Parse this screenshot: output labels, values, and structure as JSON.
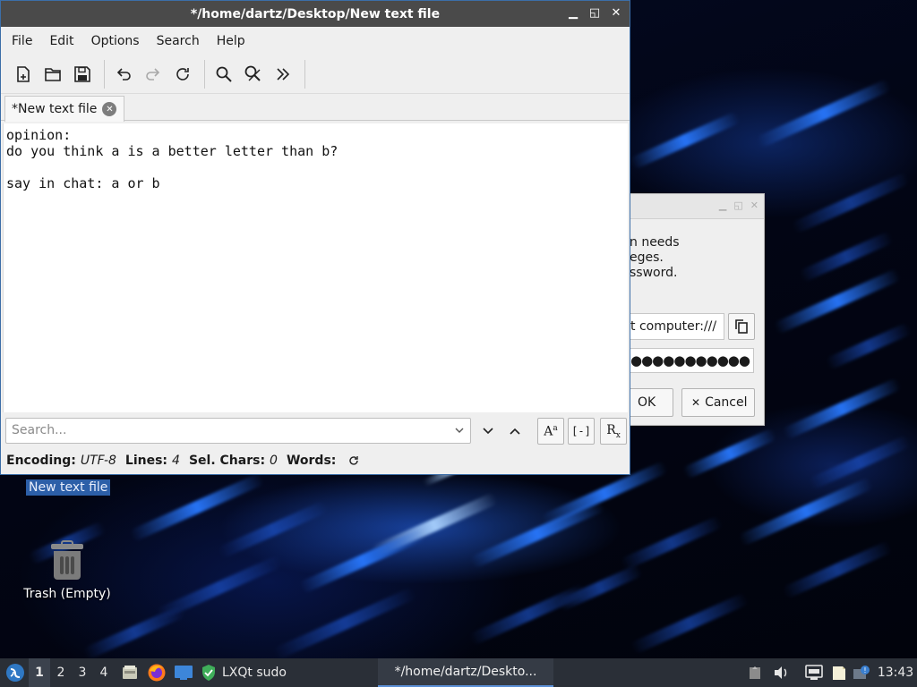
{
  "editor": {
    "title": "*/home/dartz/Desktop/New text file",
    "menu": [
      "File",
      "Edit",
      "Options",
      "Search",
      "Help"
    ],
    "tab_label": "*New text file",
    "lines": [
      "opinion:",
      "do you think a is a better letter than b?",
      "",
      "say in chat: a or b"
    ],
    "search_placeholder": "Search...",
    "status": {
      "encoding_label": "Encoding:",
      "encoding_value": "UTF-8",
      "lines_label": "Lines:",
      "lines_value": "4",
      "selchars_label": "Sel. Chars:",
      "selchars_value": "0",
      "words_label": "Words:"
    }
  },
  "dialog": {
    "message": "n needs\neges.\nssword.",
    "command": "t computer:///",
    "password_mask": "●●●●●●●●●●●",
    "ok_label": "OK",
    "cancel_label": "Cancel"
  },
  "desktop": {
    "file_label": "New text file",
    "trash_label": "Trash (Empty)"
  },
  "taskbar": {
    "desktops": [
      "1",
      "2",
      "3",
      "4"
    ],
    "active_desktop": "1",
    "sudo_label": "LXQt sudo",
    "task_title": "*/home/dartz/Deskto...",
    "clock": "13:43"
  }
}
